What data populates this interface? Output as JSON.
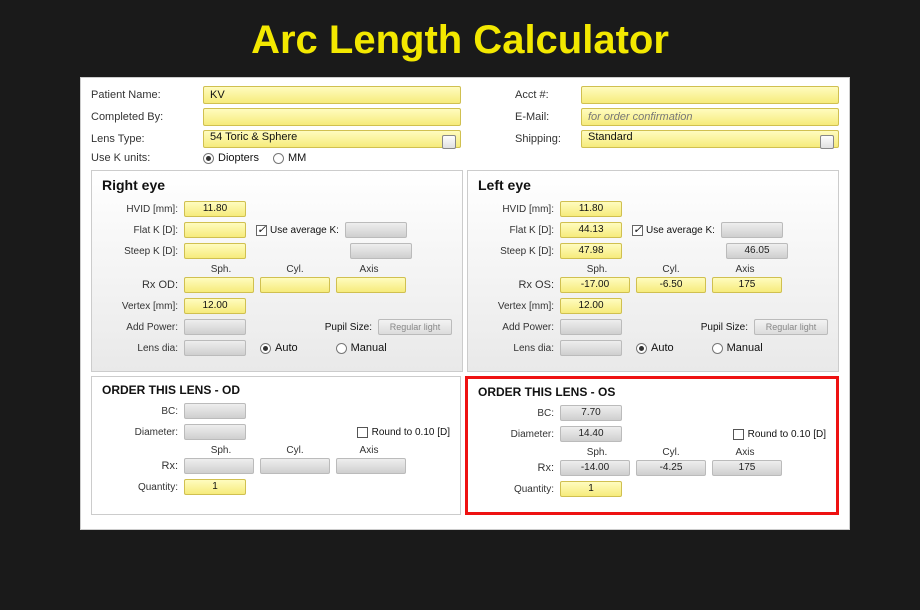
{
  "title": "Arc Length Calculator",
  "top": {
    "patientName": {
      "label": "Patient Name:",
      "value": "KV"
    },
    "acct": {
      "label": "Acct #:",
      "value": ""
    },
    "completedBy": {
      "label": "Completed By:",
      "value": ""
    },
    "email": {
      "label": "E-Mail:",
      "value": "for order confirmation"
    },
    "lensType": {
      "label": "Lens Type:",
      "value": "54 Toric & Sphere"
    },
    "shipping": {
      "label": "Shipping:",
      "value": "Standard"
    },
    "useK": {
      "label": "Use K units:",
      "opt1": "Diopters",
      "opt2": "MM"
    }
  },
  "headers": {
    "sph": "Sph.",
    "cyl": "Cyl.",
    "axis": "Axis"
  },
  "labels": {
    "hvid": "HVID [mm]:",
    "flatK": "Flat K [D]:",
    "steepK": "Steep K [D]:",
    "useAvgK": "Use average K:",
    "rxOD": "Rx OD:",
    "rxOS": "Rx OS:",
    "vertex": "Vertex [mm]:",
    "addPower": "Add Power:",
    "pupil": "Pupil Size:",
    "pupilBtn": "Regular light",
    "lensDia": "Lens dia:",
    "auto": "Auto",
    "manual": "Manual",
    "bc": "BC:",
    "diameter": "Diameter:",
    "rx": "Rx:",
    "qty": "Quantity:",
    "round": "Round to 0.10 [D]"
  },
  "right": {
    "title": "Right eye",
    "hvid": "11.80",
    "flatK": "",
    "avgK": "",
    "steepK": "",
    "steepK2": "",
    "sph": "",
    "cyl": "",
    "axis": "",
    "vertex": "12.00",
    "addPower": "",
    "lensDia": "",
    "order": {
      "title": "ORDER THIS LENS - OD",
      "bc": "",
      "dia": "",
      "sph": "",
      "cyl": "",
      "axis": "",
      "qty": "1"
    }
  },
  "left": {
    "title": "Left eye",
    "hvid": "11.80",
    "flatK": "44.13",
    "avgK": "",
    "steepK": "47.98",
    "steepK2": "46.05",
    "sph": "-17.00",
    "cyl": "-6.50",
    "axis": "175",
    "vertex": "12.00",
    "addPower": "",
    "lensDia": "",
    "order": {
      "title": "ORDER THIS LENS - OS",
      "bc": "7.70",
      "dia": "14.40",
      "sph": "-14.00",
      "cyl": "-4.25",
      "axis": "175",
      "qty": "1"
    }
  }
}
